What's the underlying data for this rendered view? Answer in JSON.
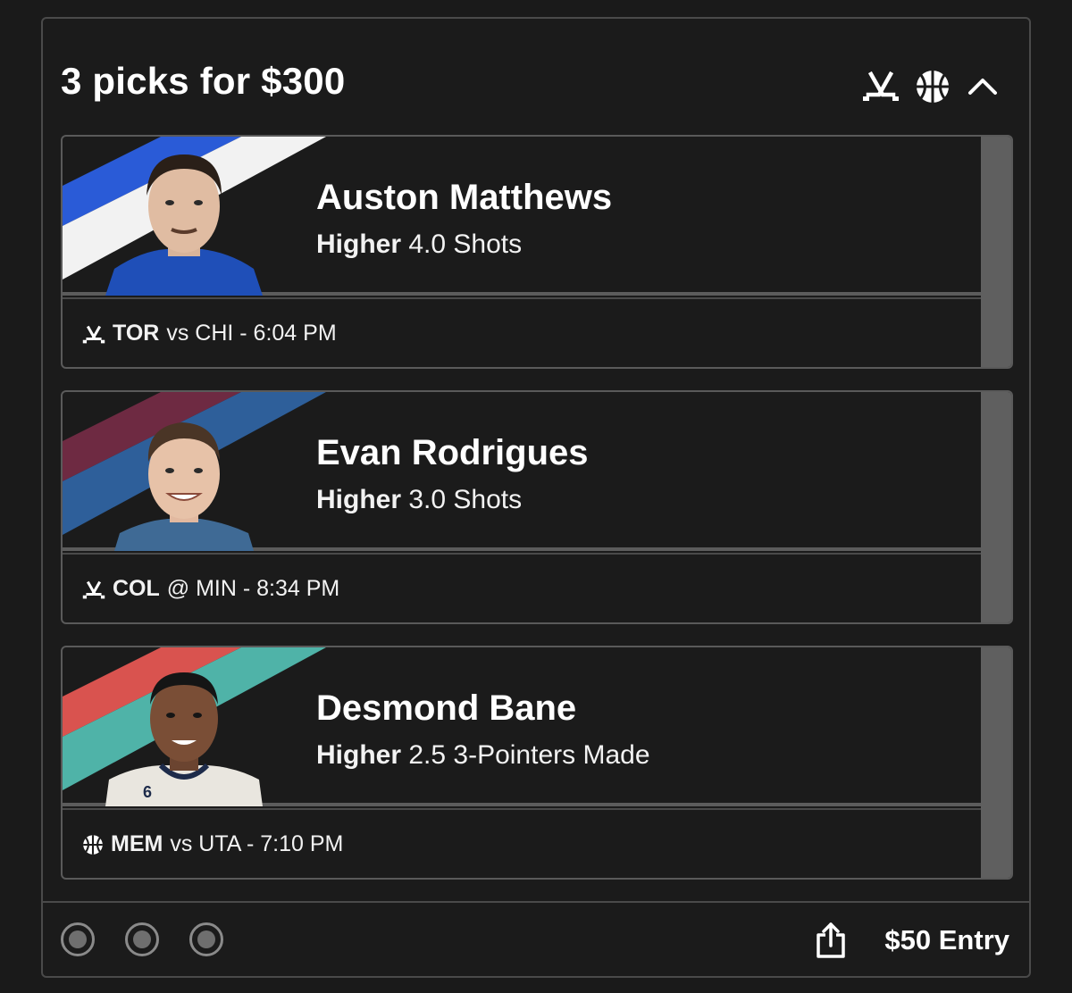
{
  "entry": {
    "title": "3 picks for $300",
    "header_icons": [
      "hockey-icon",
      "basketball-icon",
      "chevron-up-icon"
    ],
    "entry_label": "$50 Entry",
    "share_icon": "share-icon"
  },
  "picks": [
    {
      "player": "Auston Matthews",
      "direction": "Higher",
      "line": "4.0 Shots",
      "sport_icon": "hockey-icon",
      "team": "TOR",
      "matchup": "vs CHI - 6:04 PM",
      "stripe_colors": [
        "#2a5bd7",
        "#f2f2f2"
      ],
      "jersey_color": "#1f4fb8"
    },
    {
      "player": "Evan Rodrigues",
      "direction": "Higher",
      "line": "3.0 Shots",
      "sport_icon": "hockey-icon",
      "team": "COL",
      "matchup": "@ MIN - 8:34 PM",
      "stripe_colors": [
        "#6e2a42",
        "#2e5f9a"
      ],
      "jersey_color": "#3f6a95"
    },
    {
      "player": "Desmond Bane",
      "direction": "Higher",
      "line": "2.5 3-Pointers Made",
      "sport_icon": "basketball-icon",
      "team": "MEM",
      "matchup": "vs UTA - 7:10 PM",
      "stripe_colors": [
        "#d9534f",
        "#4fb3a8"
      ],
      "jersey_color": "#e9e6df",
      "jersey_number": "6"
    }
  ],
  "progress_dots": 3
}
